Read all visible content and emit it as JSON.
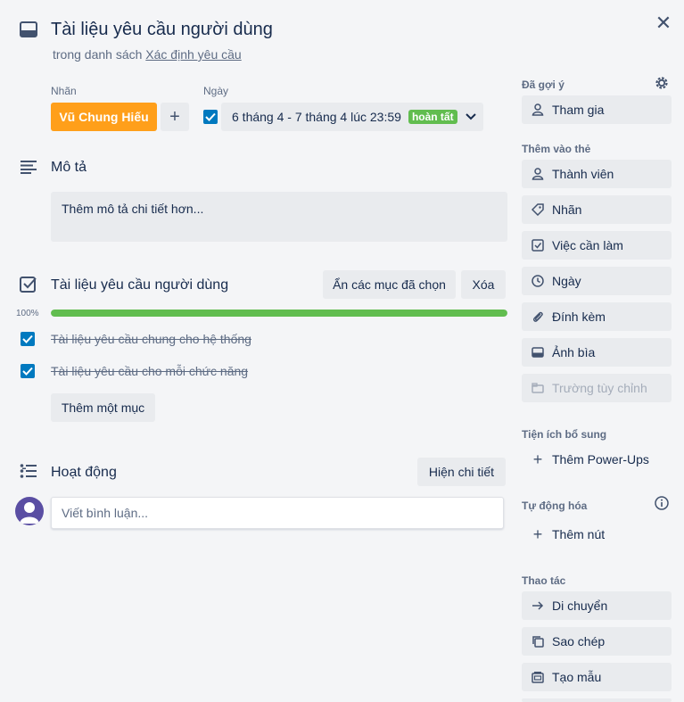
{
  "card": {
    "title": "Tài liệu yêu cầu người dùng",
    "subtitle_prefix": "trong danh sách",
    "list_name": "Xác định yêu cầu"
  },
  "labels": {
    "heading": "Nhãn",
    "items": [
      {
        "text": "Vũ Chung Hiếu",
        "color": "#ff9f1a"
      }
    ],
    "add": "+"
  },
  "dates": {
    "heading": "Ngày",
    "value": "6 tháng 4 - 7 tháng 4 lúc 23:59",
    "status": "hoàn tất",
    "checked": true
  },
  "description": {
    "heading": "Mô tả",
    "placeholder": "Thêm mô tả chi tiết hơn..."
  },
  "checklist": {
    "title": "Tài liệu yêu cầu người dùng",
    "hide_checked": "Ẩn các mục đã chọn",
    "delete": "Xóa",
    "percent_label": "100%",
    "progress": 1.0,
    "items": [
      {
        "text": "Tài liệu yêu cầu chung cho hệ thống",
        "done": true
      },
      {
        "text": "Tài liệu yêu cầu cho mỗi chức năng",
        "done": true
      }
    ],
    "add_item": "Thêm một mục"
  },
  "activity": {
    "heading": "Hoạt động",
    "show_details": "Hiện chi tiết",
    "comment_placeholder": "Viết bình luận..."
  },
  "sidebar": {
    "suggested": {
      "heading": "Đã gợi ý",
      "join": "Tham gia"
    },
    "add_to_card": {
      "heading": "Thêm vào thẻ",
      "items": [
        "Thành viên",
        "Nhãn",
        "Việc cần làm",
        "Ngày",
        "Đính kèm",
        "Ảnh bìa",
        "Trường tùy chỉnh"
      ]
    },
    "power_ups": {
      "heading": "Tiện ích bổ sung",
      "add": "Thêm Power-Ups"
    },
    "automation": {
      "heading": "Tự động hóa",
      "add_button": "Thêm nút"
    },
    "actions": {
      "heading": "Thao tác",
      "items": [
        "Di chuyển",
        "Sao chép",
        "Tạo mẫu"
      ]
    }
  },
  "colors": {
    "accent": "#0079bf",
    "success": "#61bd4f",
    "label_orange": "#ff9f1a"
  }
}
